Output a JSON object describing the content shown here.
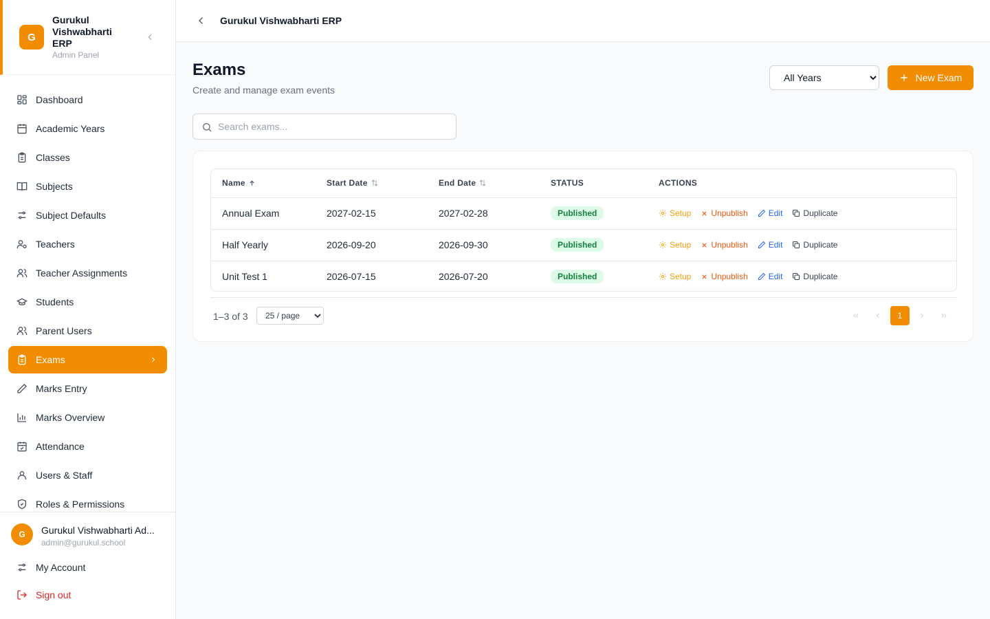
{
  "brand": {
    "logo_letter": "G",
    "name": "Gurukul Vishwabharti ERP",
    "subtitle": "Admin Panel"
  },
  "topbar": {
    "title": "Gurukul Vishwabharti ERP"
  },
  "sidebar": {
    "items": [
      {
        "label": "Dashboard",
        "icon": "dashboard-icon"
      },
      {
        "label": "Academic Years",
        "icon": "calendar-icon"
      },
      {
        "label": "Classes",
        "icon": "clipboard-icon"
      },
      {
        "label": "Subjects",
        "icon": "book-icon"
      },
      {
        "label": "Subject Defaults",
        "icon": "sliders-icon"
      },
      {
        "label": "Teachers",
        "icon": "user-cog-icon"
      },
      {
        "label": "Teacher Assignments",
        "icon": "users-icon"
      },
      {
        "label": "Students",
        "icon": "graduation-cap-icon"
      },
      {
        "label": "Parent Users",
        "icon": "users-icon"
      },
      {
        "label": "Exams",
        "icon": "clipboard-list-icon",
        "active": true
      },
      {
        "label": "Marks Entry",
        "icon": "pencil-icon"
      },
      {
        "label": "Marks Overview",
        "icon": "bar-chart-icon"
      },
      {
        "label": "Attendance",
        "icon": "calendar-check-icon"
      },
      {
        "label": "Users & Staff",
        "icon": "user-icon"
      },
      {
        "label": "Roles & Permissions",
        "icon": "shield-icon"
      }
    ]
  },
  "user": {
    "avatar_letter": "G",
    "name": "Gurukul Vishwabharti Ad...",
    "email": "admin@gurukul.school",
    "account_label": "My Account",
    "signout_label": "Sign out"
  },
  "page": {
    "title": "Exams",
    "subtitle": "Create and manage exam events",
    "year_filter": {
      "selected": "All Years"
    },
    "new_button": "New Exam",
    "search_placeholder": "Search exams..."
  },
  "table": {
    "headers": {
      "name": "Name",
      "start": "Start Date",
      "end": "End Date",
      "status": "STATUS",
      "actions": "ACTIONS"
    },
    "actions": {
      "setup": "Setup",
      "unpublish": "Unpublish",
      "edit": "Edit",
      "duplicate": "Duplicate"
    },
    "rows": [
      {
        "name": "Annual Exam",
        "start": "2027-02-15",
        "end": "2027-02-28",
        "status": "Published"
      },
      {
        "name": "Half Yearly",
        "start": "2026-09-20",
        "end": "2026-09-30",
        "status": "Published"
      },
      {
        "name": "Unit Test 1",
        "start": "2026-07-15",
        "end": "2026-07-20",
        "status": "Published"
      }
    ]
  },
  "pagination": {
    "range": "1–3 of 3",
    "per_page": "25 / page",
    "current_page": "1"
  },
  "colors": {
    "accent": "#f28c00",
    "published_bg": "#dcfce7",
    "published_text": "#15803d",
    "danger": "#dc2626"
  }
}
